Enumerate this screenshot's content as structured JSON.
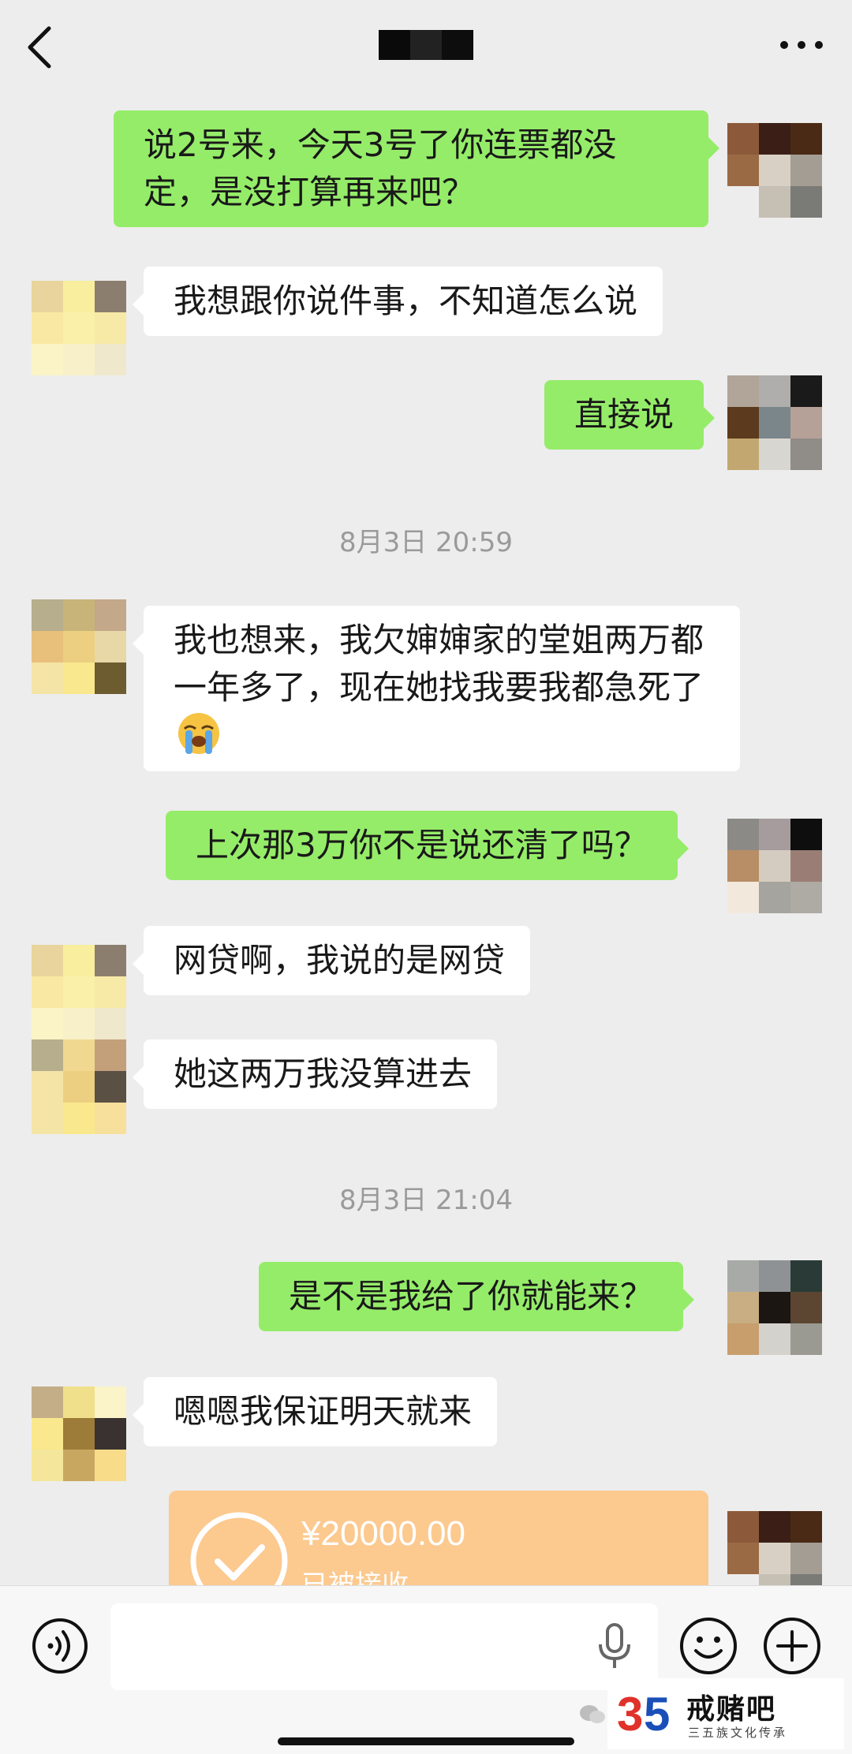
{
  "header": {
    "back_icon": "back-chevron-icon",
    "more_icon": "more-dots-icon",
    "title_redacted": true
  },
  "messages": [
    {
      "side": "right",
      "text": "说2号来，今天3号了你连票都没定，是没打算再来吧？"
    },
    {
      "side": "left",
      "text": "我想跟你说件事，不知道怎么说"
    },
    {
      "side": "right",
      "text": "直接说"
    },
    {
      "kind": "timestamp",
      "text": "8月3日 20:59"
    },
    {
      "side": "left",
      "text": "我也想来，我欠婶婶家的堂姐两万都一年多了，现在她找我要我都急死了",
      "emoji": "loudly-crying-face-icon"
    },
    {
      "side": "right",
      "text": "上次那3万你不是说还清了吗？"
    },
    {
      "side": "left",
      "text": "网贷啊，我说的是网贷"
    },
    {
      "side": "left",
      "text": "她这两万我没算进去"
    },
    {
      "kind": "timestamp",
      "text": "8月3日 21:04"
    },
    {
      "side": "right",
      "text": "是不是我给了你就能来？"
    },
    {
      "side": "left",
      "text": "嗯嗯我保证明天就来"
    }
  ],
  "transfer": {
    "amount": "¥20000.00",
    "status": "已被接收",
    "icon": "check-circle-icon",
    "color": "#fcc98f"
  },
  "input_bar": {
    "voice_icon": "voice-input-icon",
    "mic_icon": "microphone-icon",
    "emoji_icon": "emoji-face-icon",
    "plus_icon": "plus-circle-icon",
    "text_value": ""
  },
  "watermark": {
    "logo_text": "35",
    "title": "戒赌吧",
    "subtitle": "三五族文化传承"
  },
  "colors": {
    "background": "#ededed",
    "bubble_self": "#95ec69",
    "bubble_other": "#ffffff",
    "timestamp": "#9a9a9a"
  }
}
